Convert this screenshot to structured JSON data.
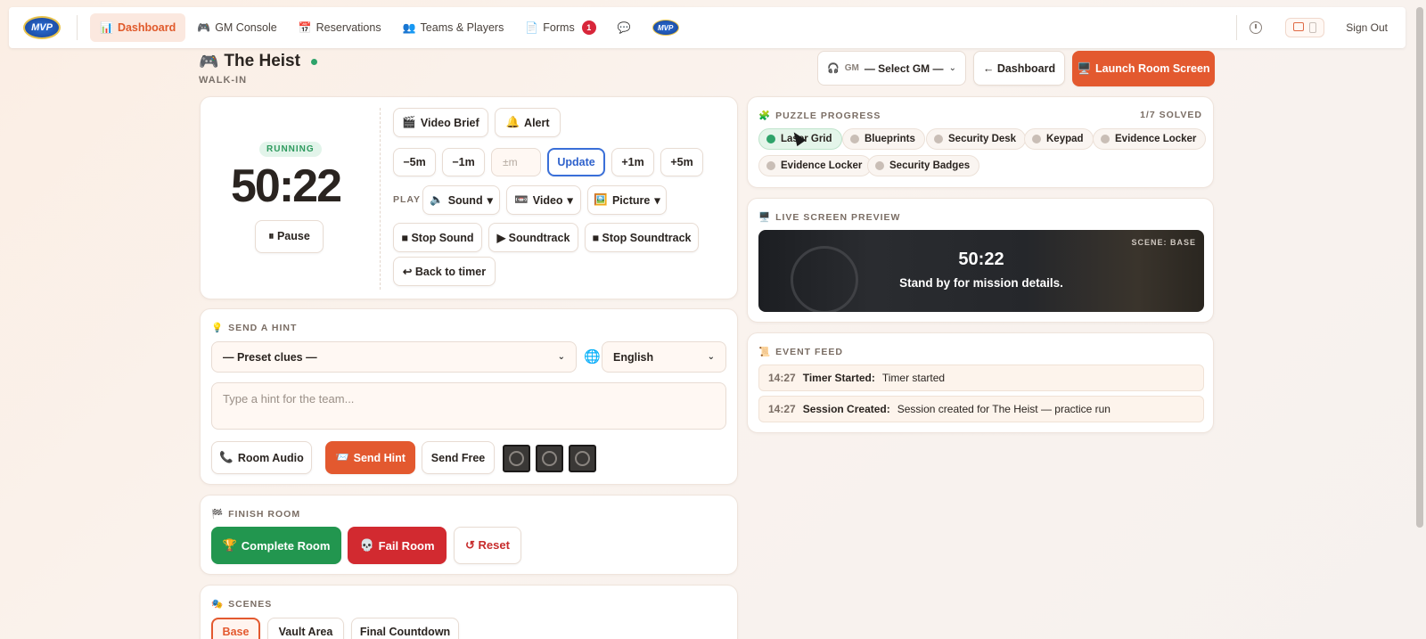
{
  "nav": {
    "logo_text": "MVP",
    "items": [
      {
        "label": "Dashboard",
        "icon": "📊"
      },
      {
        "label": "GM Console",
        "icon": "🎮"
      },
      {
        "label": "Reservations",
        "icon": "📅"
      },
      {
        "label": "Teams & Players",
        "icon": "👥"
      },
      {
        "label": "Forms",
        "icon": "📄",
        "badge": "1"
      }
    ],
    "chat_icon": "💬",
    "sign_out": "Sign Out"
  },
  "room": {
    "icon": "🎮",
    "title": "The Heist",
    "subtitle": "WALK-IN"
  },
  "header": {
    "gm_label": "GM",
    "gm_value": "— Select GM —",
    "dashboard_btn": "← Dashboard",
    "launch_btn": "Launch Room Screen",
    "launch_icon": "🖥️"
  },
  "timer": {
    "status": "RUNNING",
    "time": "50:22",
    "pause": "⏸ Pause",
    "video_brief": "Video Brief",
    "video_brief_icon": "🎬",
    "alert": "Alert",
    "alert_icon": "🔔",
    "minus5": "−5m",
    "minus1": "−1m",
    "adj_placeholder": "±m",
    "update": "Update",
    "plus1": "+1m",
    "plus5": "+5m",
    "play_label": "PLAY",
    "sound": "Sound",
    "sound_icon": "🔈",
    "video": "Video",
    "video_icon": "📼",
    "picture": "Picture",
    "picture_icon": "🖼️",
    "stop_sound": "■ Stop Sound",
    "soundtrack": "▶ Soundtrack",
    "stop_soundtrack": "■ Stop Soundtrack",
    "back_to_timer": "↩ Back to timer"
  },
  "hint": {
    "title": "SEND A HINT",
    "title_icon": "💡",
    "preset": "— Preset clues —",
    "language": "English",
    "placeholder": "Type a hint for the team...",
    "room_audio": "Room Audio",
    "room_audio_icon": "📞",
    "send_hint": "Send Hint",
    "send_hint_icon": "📨",
    "send_free": "Send Free"
  },
  "finish": {
    "title": "FINISH ROOM",
    "title_icon": "🏁",
    "complete": "Complete Room",
    "complete_icon": "🏆",
    "fail": "Fail Room",
    "fail_icon": "💀",
    "reset": "↺ Reset"
  },
  "scenes": {
    "title": "SCENES",
    "title_icon": "🎭",
    "items": [
      "Base",
      "Vault Area",
      "Final Countdown"
    ]
  },
  "puzzles": {
    "title": "PUZZLE PROGRESS",
    "title_icon": "🧩",
    "solved": "1/7 SOLVED",
    "items": [
      "Laser Grid",
      "Blueprints",
      "Security Desk",
      "Keypad",
      "Evidence Locker",
      "Evidence Locker",
      "Security Badges"
    ]
  },
  "preview": {
    "title": "LIVE SCREEN PREVIEW",
    "title_icon": "🖥️",
    "scene": "SCENE: BASE",
    "time": "50:22",
    "message": "Stand by for mission details."
  },
  "feed": {
    "title": "EVENT FEED",
    "title_icon": "📜",
    "events": [
      {
        "time": "14:27",
        "type": "Timer Started:",
        "text": "Timer started"
      },
      {
        "time": "14:27",
        "type": "Session Created:",
        "text": "Session created for The Heist — practice run"
      }
    ]
  },
  "colors": {
    "accent": "#e3592f",
    "success": "#22964f",
    "danger": "#d22a30",
    "link": "#3a6fd8"
  }
}
